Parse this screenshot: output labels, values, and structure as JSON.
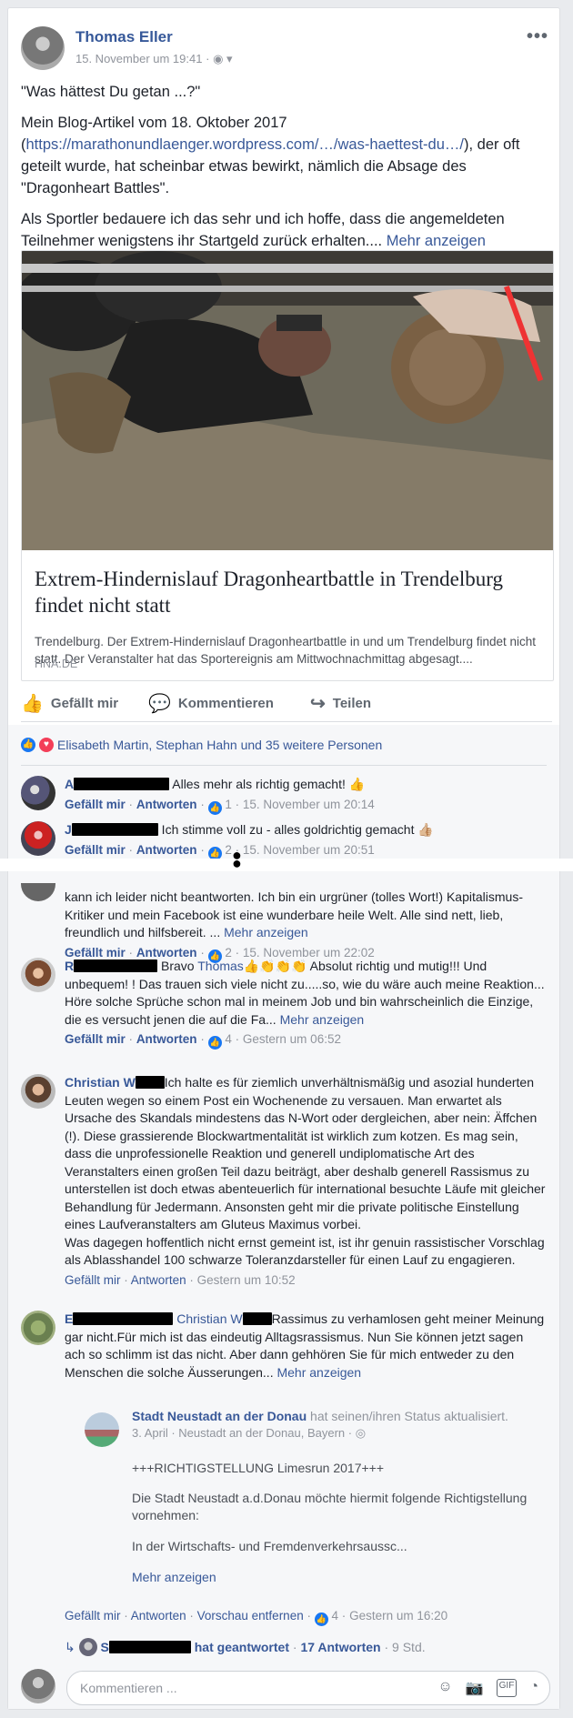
{
  "post": {
    "author": "Thomas Eller",
    "date": "15. November um 19:41",
    "separator": "·",
    "more": "•••",
    "text1": "\"Was hättest Du getan ...?\"",
    "text2_a": "Mein Blog-Artikel vom 18. Oktober 2017 (",
    "text2_link": "https://marathonundlaenger.wordpress.com/…/was-haettest-du…/",
    "text2_b": "), der oft geteilt wurde, hat scheinbar etwas bewirkt, nämlich die Absage des \"Dragonheart Battles\".",
    "text3": "Als Sportler bedauere ich das sehr und ich hoffe, dass die angemeldeten Teilnehmer wenigstens ihr Startgeld zurück erhalten....",
    "more_link": "Mehr anzeigen"
  },
  "link_card": {
    "title": "Extrem-Hindernislauf Dragonheartbattle in Trendelburg findet nicht statt",
    "description": "Trendelburg. Der Extrem-Hindernislauf Dragonheartbattle in und um Trendelburg findet nicht statt. Der Veranstalter hat das Sportereignis am Mittwochnachmittag abgesagt....",
    "source": "HNA.DE"
  },
  "actions": {
    "like": "Gefällt mir",
    "comment": "Kommentieren",
    "share": "Teilen"
  },
  "reactions": {
    "summary": "Elisabeth Martin, Stephan Hahn und 35 weitere Personen"
  },
  "labels": {
    "like": "Gefällt mir",
    "reply": "Antworten",
    "dot": "·",
    "hide_preview": "Vorschau entfernen"
  },
  "comments": [
    {
      "initial": "A",
      "text": " Alles mehr als richtig gemacht! 👍",
      "count": "1",
      "time": "15. November um 20:14"
    },
    {
      "initial": "J",
      "text": " Ich stimme voll zu - alles goldrichtig gemacht 👍🏼",
      "count": "2",
      "time": "15. November um 20:51"
    },
    {
      "initial": "",
      "text": "kann ich leider nicht beantworten. Ich bin ein urgrüner (tolles Wort!) Kapitalismus-Kritiker und mein Facebook ist eine wunderbare heile Welt. Alle sind nett, lieb, freundlich und hilfsbereit. ...",
      "count": "2",
      "time": "15. November um 22:02",
      "more": "Mehr anzeigen"
    },
    {
      "initial": "R",
      "text_a": " Bravo ",
      "mention": "Thomas",
      "text_b": "👍👏👏👏 Absolut richtig und mutig!!! Und unbequem! ! Das trauen sich viele nicht zu.....so, wie du wäre auch meine Reaktion...",
      "text_c": "Höre solche Sprüche schon mal in meinem Job und bin wahrscheinlich die Einzige, die es versucht jenen die auf die Fa...",
      "count": "4",
      "time": "Gestern um 06:52",
      "more": "Mehr anzeigen"
    },
    {
      "name": "Christian W",
      "text": "Ich halte es für ziemlich unverhältnismäßig und asozial hunderten Leuten wegen so einem Post ein Wochenende zu versauen. Man erwartet als Ursache des Skandals mindestens das N-Wort oder dergleichen, aber nein: Äffchen (!). Diese grassierende Blockwartmentalität ist wirklich zum kotzen. Es mag sein, dass die unprofessionelle Reaktion und generell undiplomatische Art des Veranstalters einen großen Teil dazu beiträgt, aber deshalb generell Rassismus zu unterstellen ist doch etwas abenteuerlich für international besuchte Läufe mit gleicher Behandlung für Jedermann. Ansonsten geht mir die private politische Einstellung eines Laufveranstalters am Gluteus Maximus vorbei.",
      "text2": "Was dagegen hoffentlich nicht ernst gemeint ist, ist ihr genuin rassistischer Vorschlag als Ablasshandel 100 schwarze Toleranzdarsteller für einen Lauf zu engagieren.",
      "time": "Gestern um 10:52"
    },
    {
      "initial": "E",
      "text_a": " Christian W",
      "text_b": "Rassimus zu verhamlosen geht meiner Meinung gar nicht.Für mich ist das eindeutig Alltagsrassismus. Nun Sie können jetzt sagen ach so schlimm ist das nicht. Aber dann gehhören Sie für mich entweder zu den Menschen die solche Äusserungen...",
      "more": "Mehr anzeigen",
      "count": "4",
      "time": "Gestern um 16:20"
    }
  ],
  "shared_post": {
    "page": "Stadt Neustadt an der Donau",
    "status": " hat seinen/ihren Status aktualisiert.",
    "date": "3. April · Neustadt an der Donau, Bayern ·",
    "line1": "+++RICHTIGSTELLUNG Limesrun 2017+++",
    "line2": "Die Stadt Neustadt a.d.Donau möchte hiermit folgende Richtigstellung vornehmen:",
    "line3": "In der Wirtschafts- und Fremdenverkehrsaussc...",
    "more": "Mehr anzeigen"
  },
  "reply_summary": {
    "initial": "S",
    "text": " hat geantwortet",
    "count": "17 Antworten",
    "time": "9 Std."
  },
  "composer": {
    "placeholder": "Kommentieren ..."
  },
  "colors": {
    "brand": "#385898",
    "like_blue": "#1877f2",
    "love_red": "#f33e58"
  }
}
